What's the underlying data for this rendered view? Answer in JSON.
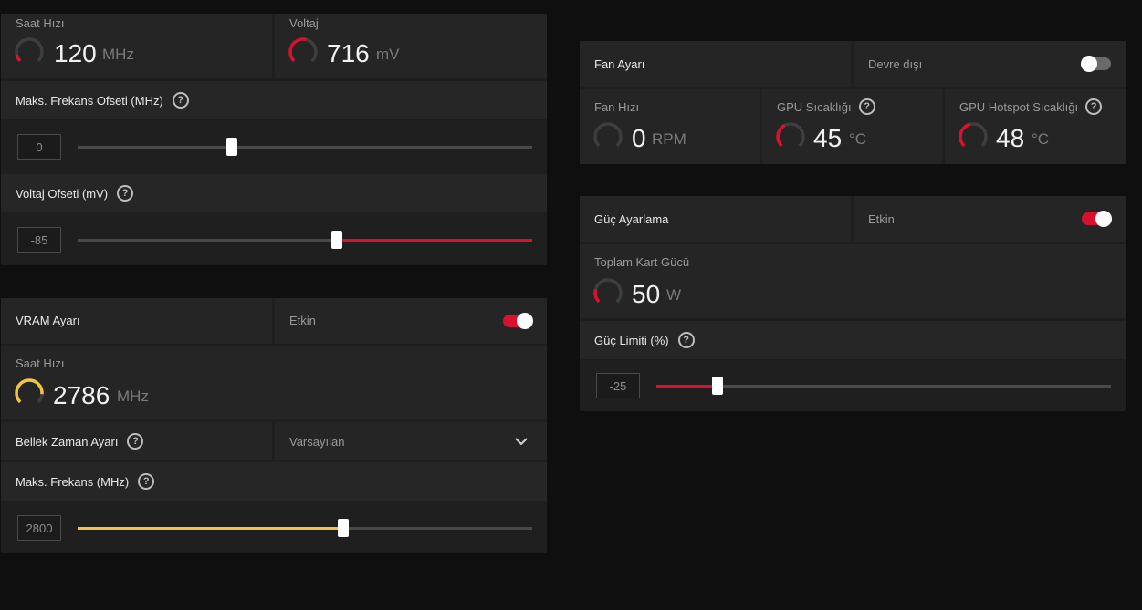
{
  "colors": {
    "red": "#d8112c",
    "yellow": "#f2c443",
    "gray": "#4a4a4a"
  },
  "gpu": {
    "clock": {
      "label": "Saat Hızı",
      "value": "120",
      "unit": "MHz",
      "gauge_fraction": 0.12
    },
    "voltage": {
      "label": "Voltaj",
      "value": "716",
      "unit": "mV",
      "gauge_fraction": 0.55
    },
    "max_freq_offset": {
      "label": "Maks. Frekans Ofseti (MHz)",
      "value": "0",
      "slider_fraction": 0.34
    },
    "voltage_offset": {
      "label": "Voltaj Ofseti (mV)",
      "value": "-85",
      "slider_fraction": 0.57
    }
  },
  "vram": {
    "title": "VRAM Ayarı",
    "state": "Etkin",
    "enabled": true,
    "clock": {
      "label": "Saat Hızı",
      "value": "2786",
      "unit": "MHz",
      "gauge_fraction": 0.85
    },
    "memory_timing": {
      "label": "Bellek Zaman Ayarı",
      "value": "Varsayılan"
    },
    "max_freq": {
      "label": "Maks. Frekans (MHz)",
      "value": "2800",
      "slider_fraction": 0.585
    }
  },
  "fan": {
    "title": "Fan Ayarı",
    "state": "Devre dışı",
    "enabled": false,
    "speed": {
      "label": "Fan Hızı",
      "value": "0",
      "unit": "RPM",
      "gauge_fraction": 0
    },
    "gpu_temp": {
      "label": "GPU Sıcaklığı",
      "value": "45",
      "unit": "°C",
      "gauge_fraction": 0.4
    },
    "hotspot_temp": {
      "label": "GPU Hotspot Sıcaklığı",
      "value": "48",
      "unit": "°C",
      "gauge_fraction": 0.45
    }
  },
  "power": {
    "title": "Güç Ayarlama",
    "state": "Etkin",
    "enabled": true,
    "total_power": {
      "label": "Toplam Kart Gücü",
      "value": "50",
      "unit": "W",
      "gauge_fraction": 0.22
    },
    "power_limit": {
      "label": "Güç Limiti (%)",
      "value": "-25",
      "slider_fraction": 0.134
    }
  }
}
